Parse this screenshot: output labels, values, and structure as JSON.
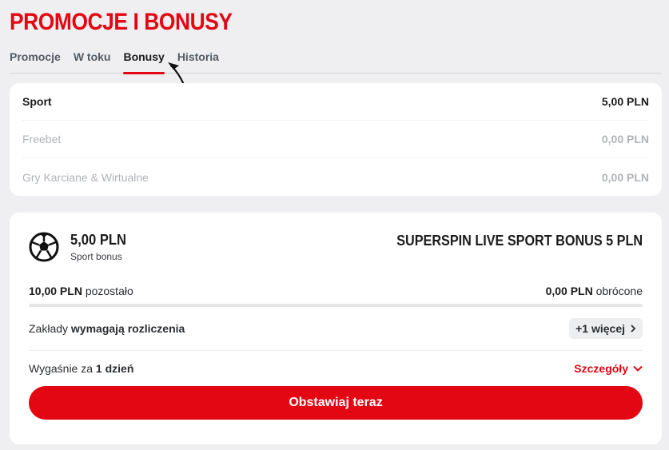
{
  "page": {
    "title": "PROMOCJE I BONUSY"
  },
  "tabs": [
    {
      "label": "Promocje"
    },
    {
      "label": "W toku"
    },
    {
      "label": "Bonusy",
      "active": true
    },
    {
      "label": "Historia"
    }
  ],
  "balances": [
    {
      "label": "Sport",
      "value": "5,00 PLN"
    },
    {
      "label": "Freebet",
      "value": "0,00 PLN"
    },
    {
      "label": "Gry Karciane & Wirtualne",
      "value": "0,00 PLN"
    }
  ],
  "bonus": {
    "icon": "soccer-ball-icon",
    "amount": "5,00 PLN",
    "type": "Sport bonus",
    "name": "SUPERSPIN LIVE SPORT BONUS 5 PLN",
    "remaining_value": "10,00 PLN",
    "remaining_label": "pozostało",
    "turned_value": "0,00 PLN",
    "turned_label": "obrócone",
    "progress": 0,
    "bets_prefix": "Zakłady",
    "bets_bold": "wymagają rozliczenia",
    "more_label": "+1 więcej",
    "expires_prefix": "Wygaśnie za",
    "expires_bold": "1 dzień",
    "details_label": "Szczegóły",
    "cta_label": "Obstawiaj teraz"
  },
  "colors": {
    "accent": "#e30613",
    "background": "#efeff1",
    "card": "#ffffff"
  }
}
